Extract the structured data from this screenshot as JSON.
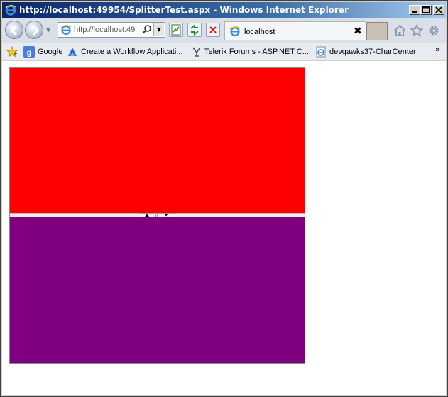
{
  "window": {
    "title": "http://localhost:49954/SplitterTest.aspx - Windows Internet Explorer"
  },
  "navbar": {
    "address_text": "http://localhost:49",
    "tab_label": "localhost",
    "tab_close": "✖"
  },
  "favorites": {
    "items": [
      {
        "label": "Google",
        "icon": "google-icon"
      },
      {
        "label": "Create a Workflow Applicati...",
        "icon": "workflow-icon"
      },
      {
        "label": "Telerik Forums - ASP.NET C...",
        "icon": "telerik-icon"
      },
      {
        "label": "devqawks37-CharCenter",
        "icon": "ie-page-icon"
      }
    ],
    "chevron": "»"
  },
  "splitter": {
    "top_pane_color": "#ff0000",
    "bottom_pane_color": "#800080"
  }
}
